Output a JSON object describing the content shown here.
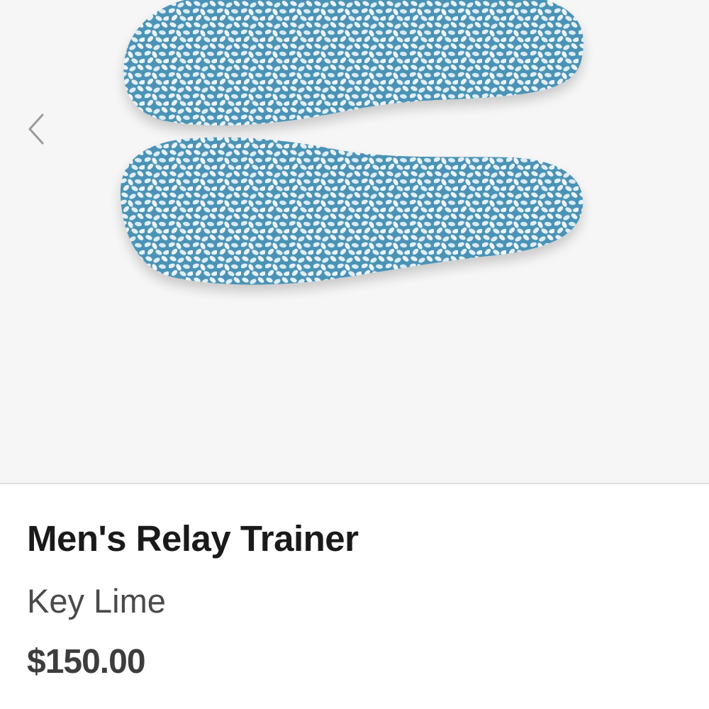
{
  "gallery": {
    "prev_icon": "chevron-left-icon",
    "image_subject": "insole-pair"
  },
  "product": {
    "name": "Men's Relay Trainer",
    "color": "Key Lime",
    "price": "$150.00"
  },
  "colors": {
    "gallery_bg": "#f6f6f6",
    "insole_base": "#3d8bb0",
    "insole_speckle": "#e8f3f8",
    "title_text": "#1a1a1a",
    "price_text": "#3d3d3d"
  }
}
